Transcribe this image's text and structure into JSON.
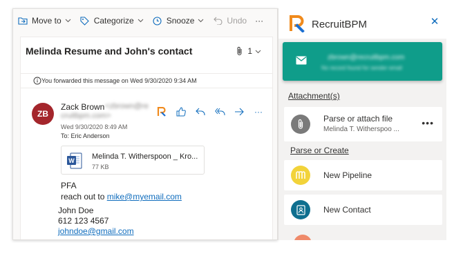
{
  "toolbar": {
    "move_to": "Move to",
    "categorize": "Categorize",
    "snooze": "Snooze",
    "undo": "Undo",
    "more": "···"
  },
  "email": {
    "subject": "Melinda Resume and John's contact",
    "attachment_count": "1",
    "forward_notice": "You forwarded this message on Wed 9/30/2020 9:34 AM",
    "sender": {
      "initials": "ZB",
      "name": "Zack Brown",
      "email_line1": "<zbrown@re",
      "email_line2": "cruitbpm.com>",
      "avatar_color": "#a4262c"
    },
    "date": "Wed 9/30/2020 8:49 AM",
    "to": "To:  Eric Anderson",
    "attachment": {
      "name": "Melinda T. Witherspoon _ Kro...",
      "size": "77 KB"
    },
    "body": {
      "line1": "PFA",
      "line2_prefix": "reach out to ",
      "line2_link": "mike@myemail.com",
      "sig_name": "John Doe",
      "sig_phone": "612 123 4567",
      "sig_email": "johndoe@gmail.com"
    }
  },
  "addin": {
    "title": "RecruitBPM",
    "close": "✕",
    "banner": {
      "email": "zbrown@recruitbpm.com",
      "note": "No record found for sender email",
      "color": "#0f9d8a"
    },
    "attachments_section": "Attachment(s)",
    "attachment_item": {
      "label": "Parse or attach file",
      "sub": "Melinda T. Witherspoo ...",
      "more": "•••"
    },
    "parse_section": "Parse or Create",
    "pipeline_label": "New Pipeline",
    "contact_label": "New Contact",
    "colors": {
      "pipeline": "#f2d33a",
      "contact": "#0f6f8f",
      "attach": "#7a7a7a",
      "brand_orange": "#f08a1c",
      "brand_blue": "#1c6fd1"
    }
  }
}
